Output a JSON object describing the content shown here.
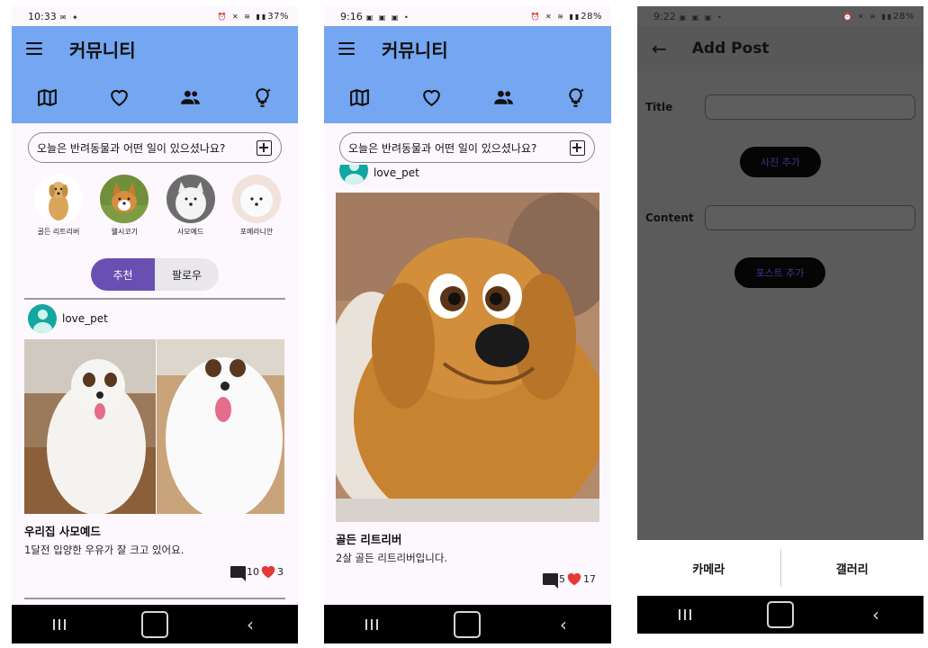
{
  "screens": [
    {
      "status": {
        "time": "10:33",
        "right": "37%"
      },
      "appbar_title": "커뮤니티",
      "search_placeholder": "오늘은 반려동물과 어떤 일이 있으셨나요?",
      "breeds": [
        {
          "label": "골든 리트리버"
        },
        {
          "label": "웰시코기"
        },
        {
          "label": "사모예드"
        },
        {
          "label": "포메라니안"
        }
      ],
      "tabs": {
        "recommend": "추천",
        "follow": "팔로우"
      },
      "post": {
        "author": "love_pet",
        "title": "우리집 사모예드",
        "body": "1달전 입양한 우유가 잘 크고 있어요.",
        "comments": "10",
        "likes": "3"
      }
    },
    {
      "status": {
        "time": "9:16",
        "right": "28%"
      },
      "appbar_title": "커뮤니티",
      "search_placeholder": "오늘은 반려동물과 어떤 일이 있으셨나요?",
      "post": {
        "author": "love_pet",
        "title": "골든 리트리버",
        "body": "2살 골든 리트리버입니다.",
        "comments": "5",
        "likes": "17"
      }
    },
    {
      "status": {
        "time": "9:22",
        "right": "28%"
      },
      "title": "Add Post",
      "labels": {
        "title": "Title",
        "content": "Content"
      },
      "buttons": {
        "add_photo": "사진 추가",
        "add_post": "포스트 추가"
      },
      "sheet": {
        "camera": "카메라",
        "gallery": "갤러리"
      }
    }
  ],
  "colors": {
    "appbar": "#74a6f1",
    "accent": "#6a4fb3",
    "heart": "#e53935",
    "avatar": "#12a7a0"
  },
  "icons": [
    "menu-icon",
    "map-icon",
    "heart-icon",
    "group-icon",
    "lightbulb-icon",
    "add-box-icon",
    "comment-icon",
    "back-arrow-icon"
  ]
}
